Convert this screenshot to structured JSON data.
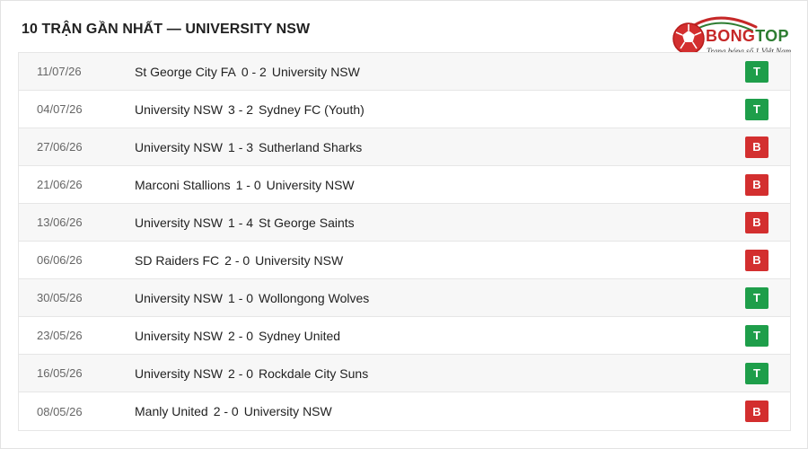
{
  "title": "10 TRẬN GẦN NHẤT — UNIVERSITY NSW",
  "logo": {
    "brand_a": "BONG",
    "brand_b": "TOP",
    "tagline": "Trang bóng số 1 Việt Nam"
  },
  "colors": {
    "win": "#1e9e4a",
    "loss": "#d32f2f",
    "brand_red": "#c62828",
    "brand_green": "#2e7d32"
  },
  "matches": [
    {
      "date": "11/07/26",
      "home": "St George City FA",
      "score": "0 - 2",
      "away": "University NSW",
      "result": "T"
    },
    {
      "date": "04/07/26",
      "home": "University NSW",
      "score": "3 - 2",
      "away": "Sydney FC (Youth)",
      "result": "T"
    },
    {
      "date": "27/06/26",
      "home": "University NSW",
      "score": "1 - 3",
      "away": "Sutherland Sharks",
      "result": "B"
    },
    {
      "date": "21/06/26",
      "home": "Marconi Stallions",
      "score": "1 - 0",
      "away": "University NSW",
      "result": "B"
    },
    {
      "date": "13/06/26",
      "home": "University NSW",
      "score": "1 - 4",
      "away": "St George Saints",
      "result": "B"
    },
    {
      "date": "06/06/26",
      "home": "SD Raiders FC",
      "score": "2 - 0",
      "away": "University NSW",
      "result": "B"
    },
    {
      "date": "30/05/26",
      "home": "University NSW",
      "score": "1 - 0",
      "away": "Wollongong Wolves",
      "result": "T"
    },
    {
      "date": "23/05/26",
      "home": "University NSW",
      "score": "2 - 0",
      "away": "Sydney United",
      "result": "T"
    },
    {
      "date": "16/05/26",
      "home": "University NSW",
      "score": "2 - 0",
      "away": "Rockdale City Suns",
      "result": "T"
    },
    {
      "date": "08/05/26",
      "home": "Manly United",
      "score": "2 - 0",
      "away": "University NSW",
      "result": "B"
    }
  ]
}
